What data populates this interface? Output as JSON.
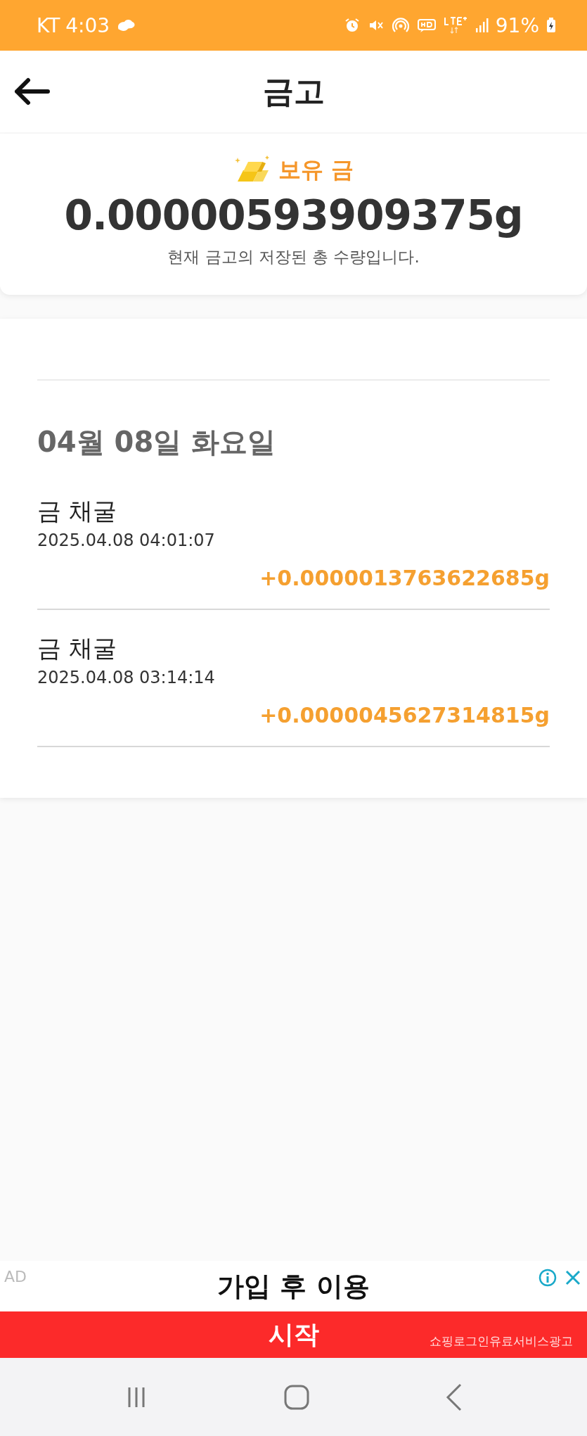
{
  "status_bar": {
    "carrier": "KT",
    "time": "4:03",
    "battery": "91%"
  },
  "header": {
    "title": "금고"
  },
  "balance": {
    "label": "보유 금",
    "amount": "0.00000593909375g",
    "caption": "현재 금고의 저장된 총 수량입니다."
  },
  "history": [
    {
      "date": "04월 08일 화요일",
      "entries": [
        {
          "title": "금 채굴",
          "time": "2025.04.08 04:01:07",
          "amount": "+0.0000013763622685g"
        },
        {
          "title": "금 채굴",
          "time": "2025.04.08 03:14:14",
          "amount": "+0.0000045627314815g"
        }
      ]
    }
  ],
  "ad": {
    "label": "AD",
    "headline": "가입 후 이용",
    "button": "시작",
    "disclaimer": "쇼핑로그인유료서비스광고"
  }
}
